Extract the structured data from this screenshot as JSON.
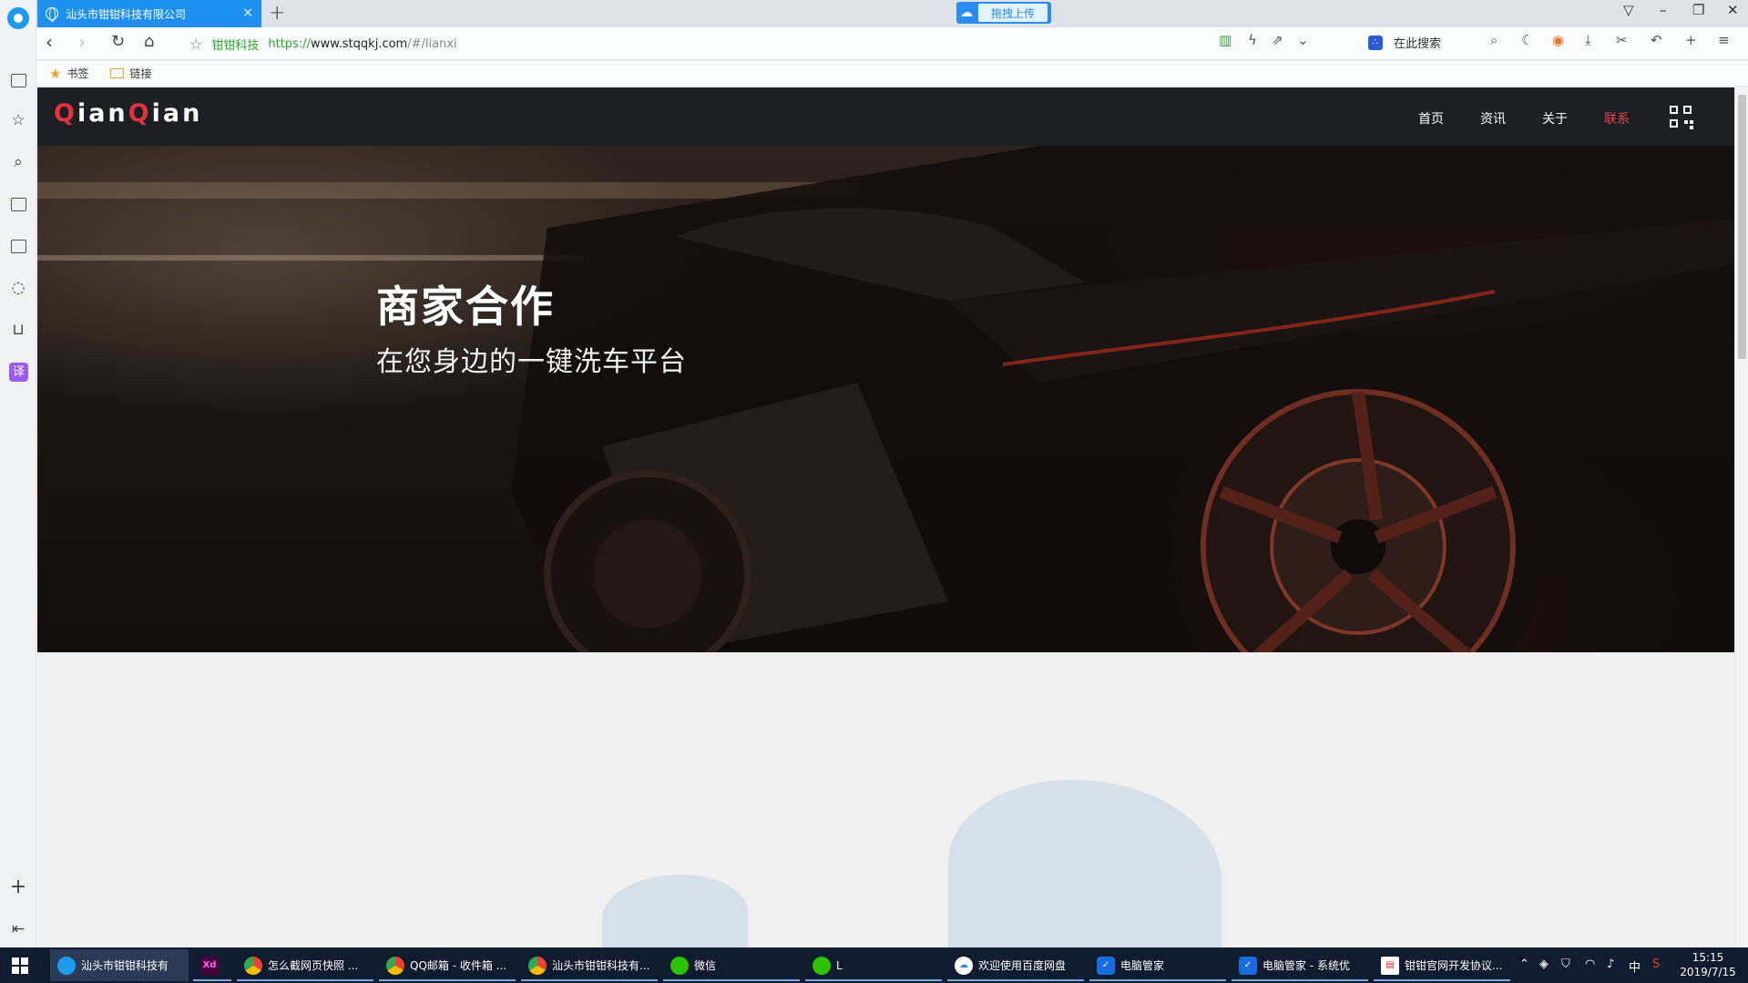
{
  "browser": {
    "tab_title": "汕头市钳钳科技有限公司",
    "tab_close": "×",
    "new_tab": "+",
    "upload_label": "拖拽上传",
    "site_name": "钳钳科技",
    "url_protocol": "https://",
    "url_host": "www.stqqkj.com",
    "url_path": "/#/lianxi",
    "search_placeholder": "在此搜索",
    "bookmarks": [
      {
        "label": "书签",
        "icon": "star-icon"
      },
      {
        "label": "链接",
        "icon": "folder-icon"
      }
    ],
    "translate_label": "译"
  },
  "site": {
    "logo": {
      "q1": "Q",
      "rest1": "ian",
      "q2": "Q",
      "rest2": "ian"
    },
    "menu": [
      "首页",
      "资讯",
      "关于",
      "联系"
    ],
    "active_menu": "联系",
    "accent_color": "#e3323c"
  },
  "hero": {
    "title": "商家合作",
    "subtitle": "在您身边的一键洗车平台"
  },
  "taskbar": {
    "items": [
      {
        "label": "汕头市钳钳科技有",
        "icon": "browser-icon",
        "state": "active"
      },
      {
        "label": "",
        "icon": "xd-icon",
        "state": "open"
      },
      {
        "label": "怎么截网页快照 ...",
        "icon": "chrome-icon",
        "state": "open"
      },
      {
        "label": "QQ邮箱 - 收件箱 ...",
        "icon": "chrome-icon",
        "state": "open"
      },
      {
        "label": "汕头市钳钳科技有...",
        "icon": "chrome-icon",
        "state": "open"
      },
      {
        "label": "微信",
        "icon": "wechat-icon",
        "state": "open"
      },
      {
        "label": "L",
        "icon": "wechat-icon",
        "state": "open"
      },
      {
        "label": "欢迎使用百度网盘",
        "icon": "baidu-netdisk-icon",
        "state": "open"
      },
      {
        "label": "电脑管家",
        "icon": "pc-manager-icon",
        "state": "open"
      },
      {
        "label": "电脑管家 - 系统优",
        "icon": "pc-manager-icon",
        "state": "open"
      },
      {
        "label": "钳钳官网开发协议...",
        "icon": "pdf-icon",
        "state": "open"
      }
    ],
    "ime": "中",
    "time": "15:15",
    "date": "2019/7/15"
  }
}
